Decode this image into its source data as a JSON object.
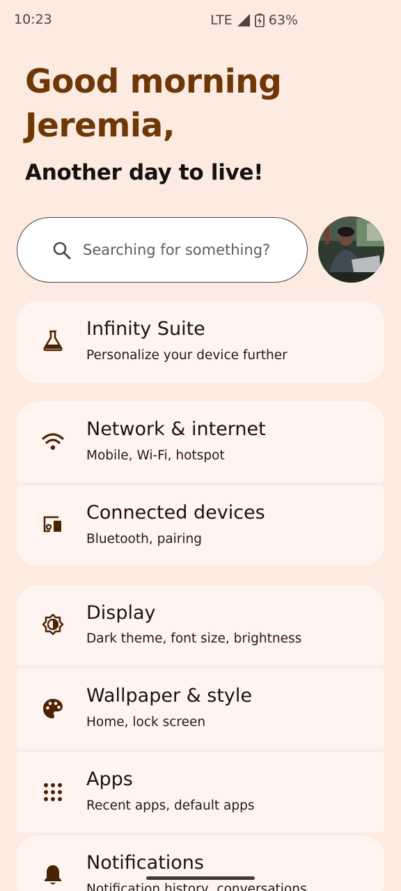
{
  "status_bar": {
    "time": "10:23",
    "network": "LTE",
    "battery": "63%"
  },
  "header": {
    "greeting_line1": "Good morning",
    "greeting_line2": "Jeremia,",
    "subtitle": "Another day to live!"
  },
  "search": {
    "placeholder": "Searching for something?"
  },
  "colors": {
    "background": "#fdeae1",
    "card": "#fff4f0",
    "accent": "#6e3706",
    "icon": "#4a2304"
  },
  "settings": [
    {
      "icon": "flask-icon",
      "title": "Infinity Suite",
      "subtitle": "Personalize your device further"
    },
    {
      "icon": "wifi-icon",
      "title": "Network & internet",
      "subtitle": "Mobile, Wi-Fi, hotspot"
    },
    {
      "icon": "connected-devices-icon",
      "title": "Connected devices",
      "subtitle": "Bluetooth, pairing"
    },
    {
      "icon": "brightness-icon",
      "title": "Display",
      "subtitle": "Dark theme, font size, brightness"
    },
    {
      "icon": "palette-icon",
      "title": "Wallpaper & style",
      "subtitle": "Home, lock screen"
    },
    {
      "icon": "apps-grid-icon",
      "title": "Apps",
      "subtitle": "Recent apps, default apps"
    },
    {
      "icon": "bell-icon",
      "title": "Notifications",
      "subtitle": "Notification history, conversations"
    }
  ]
}
